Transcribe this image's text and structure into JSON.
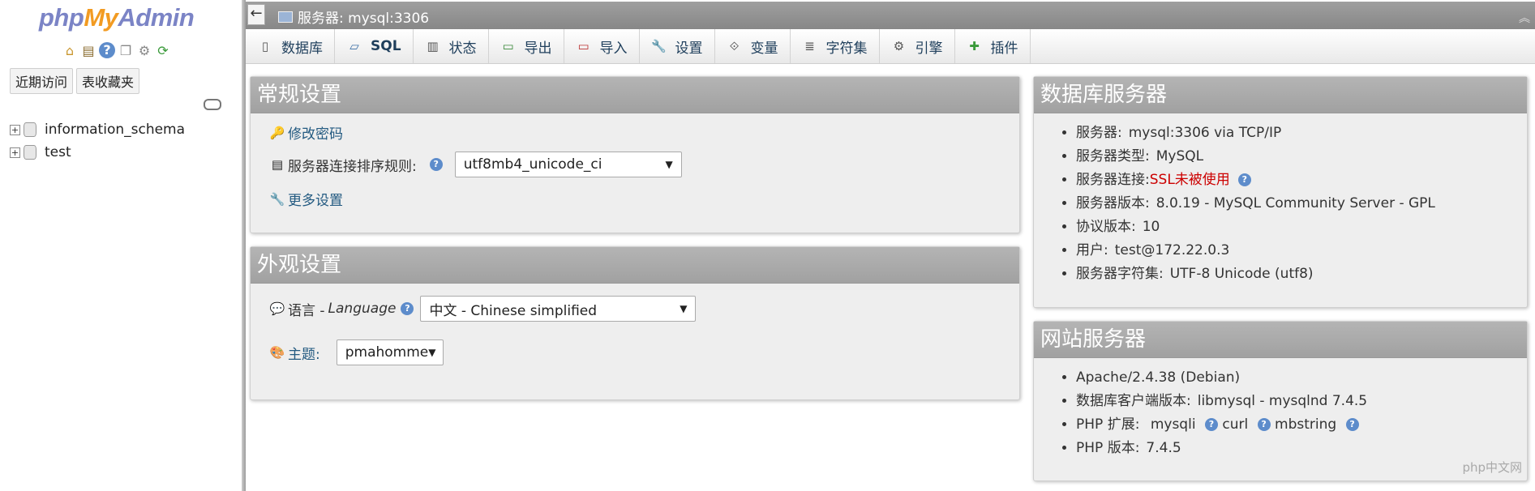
{
  "nav": {
    "logo_php": "php",
    "logo_my": "My",
    "logo_admin": "Admin",
    "icons": [
      "home-icon",
      "exit-icon",
      "help-icon",
      "docs-icon",
      "settings-icon",
      "reload-icon"
    ],
    "tab_recent": "近期访问",
    "tab_favorites": "表收藏夹",
    "databases": [
      "information_schema",
      "test"
    ]
  },
  "serverbar": {
    "title": "服务器: mysql:3306"
  },
  "menu": [
    {
      "label": "数据库",
      "icon": "database-icon"
    },
    {
      "label": "SQL",
      "icon": "sql-icon"
    },
    {
      "label": "状态",
      "icon": "status-icon"
    },
    {
      "label": "导出",
      "icon": "export-icon"
    },
    {
      "label": "导入",
      "icon": "import-icon"
    },
    {
      "label": "设置",
      "icon": "settings-icon"
    },
    {
      "label": "变量",
      "icon": "variables-icon"
    },
    {
      "label": "字符集",
      "icon": "charset-icon"
    },
    {
      "label": "引擎",
      "icon": "engine-icon"
    },
    {
      "label": "插件",
      "icon": "plugin-icon"
    }
  ],
  "general": {
    "title": "常规设置",
    "change_password": "修改密码",
    "collation_label": "服务器连接排序规则:",
    "collation_value": "utf8mb4_unicode_ci",
    "more_settings": "更多设置"
  },
  "appearance": {
    "title": "外观设置",
    "language_label": "语言 - ",
    "language_label_italic": "Language",
    "language_value": "中文 - Chinese simplified",
    "theme_label": "主题:",
    "theme_value": "pmahomme"
  },
  "db_server": {
    "title": "数据库服务器",
    "items": [
      {
        "label": "服务器:",
        "value": "mysql:3306 via TCP/IP"
      },
      {
        "label": "服务器类型:",
        "value": "MySQL"
      },
      {
        "label": "服务器连接:",
        "value": "SSL未被使用"
      },
      {
        "label": "服务器版本:",
        "value": "8.0.19 - MySQL Community Server - GPL"
      },
      {
        "label": "协议版本:",
        "value": "10"
      },
      {
        "label": "用户:",
        "value": "test@172.22.0.3"
      },
      {
        "label": "服务器字符集:",
        "value": "UTF-8 Unicode (utf8)"
      }
    ]
  },
  "web_server": {
    "title": "网站服务器",
    "apache": "Apache/2.4.38 (Debian)",
    "client_label": "数据库客户端版本:",
    "client_value": "libmysql - mysqlnd 7.4.5",
    "php_ext_label": "PHP 扩展:",
    "php_ext_1": "mysqli",
    "php_ext_2": "curl",
    "php_ext_3": "mbstring",
    "php_ver_label": "PHP 版本:",
    "php_ver_value": "7.4.5"
  },
  "watermark": "php中文网",
  "colors": {
    "accent": "#235a81",
    "header": "#a8a8a8",
    "warn": "#cc0000"
  }
}
